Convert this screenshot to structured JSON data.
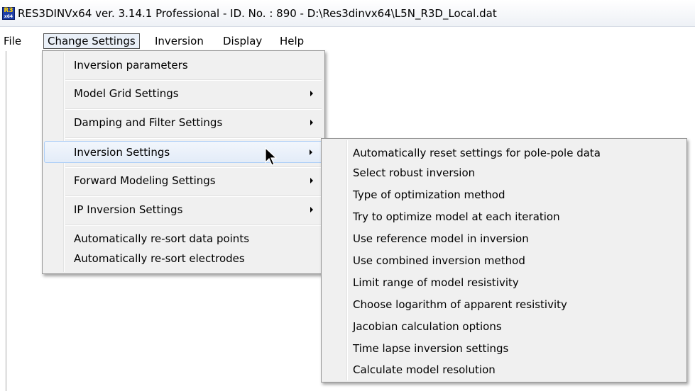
{
  "window": {
    "title": "RES3DINVx64 ver. 3.14.1 Professional - ID. No. : 890  - D:\\Res3dinvx64\\L5N_R3D_Local.dat",
    "icon": "res3dinv-app-icon",
    "icon_text_top": "R3",
    "icon_text_bottom": "x64"
  },
  "menubar": {
    "items": [
      "File",
      "Change Settings",
      "Inversion",
      "Display",
      "Help"
    ],
    "open_item": "Change Settings"
  },
  "change_settings_menu": {
    "items": [
      {
        "label": "Inversion parameters",
        "submenu": false
      },
      {
        "label": "Model Grid Settings",
        "submenu": true
      },
      {
        "label": "Damping and Filter Settings",
        "submenu": true
      },
      {
        "label": "Inversion Settings",
        "submenu": true,
        "highlighted": true
      },
      {
        "label": "Forward Modeling Settings",
        "submenu": true
      },
      {
        "label": "IP Inversion Settings",
        "submenu": true
      },
      {
        "label": "Automatically re-sort data points",
        "submenu": false
      },
      {
        "label": "Automatically re-sort electrodes",
        "submenu": false
      }
    ]
  },
  "inversion_settings_submenu": {
    "items": [
      "Automatically reset settings for pole-pole data",
      "Select robust inversion",
      "Type of optimization method",
      "Try to optimize model at each iteration",
      "Use reference model in inversion",
      "Use combined inversion method",
      "Limit range of model resistivity",
      "Choose logarithm of apparent resistivity",
      "Jacobian calculation options",
      "Time lapse inversion settings",
      "Calculate model resolution"
    ]
  },
  "colors": {
    "highlight_bg": "#e3ecf8",
    "highlight_border": "#aecff7",
    "menu_bg": "#f0f0f0"
  }
}
